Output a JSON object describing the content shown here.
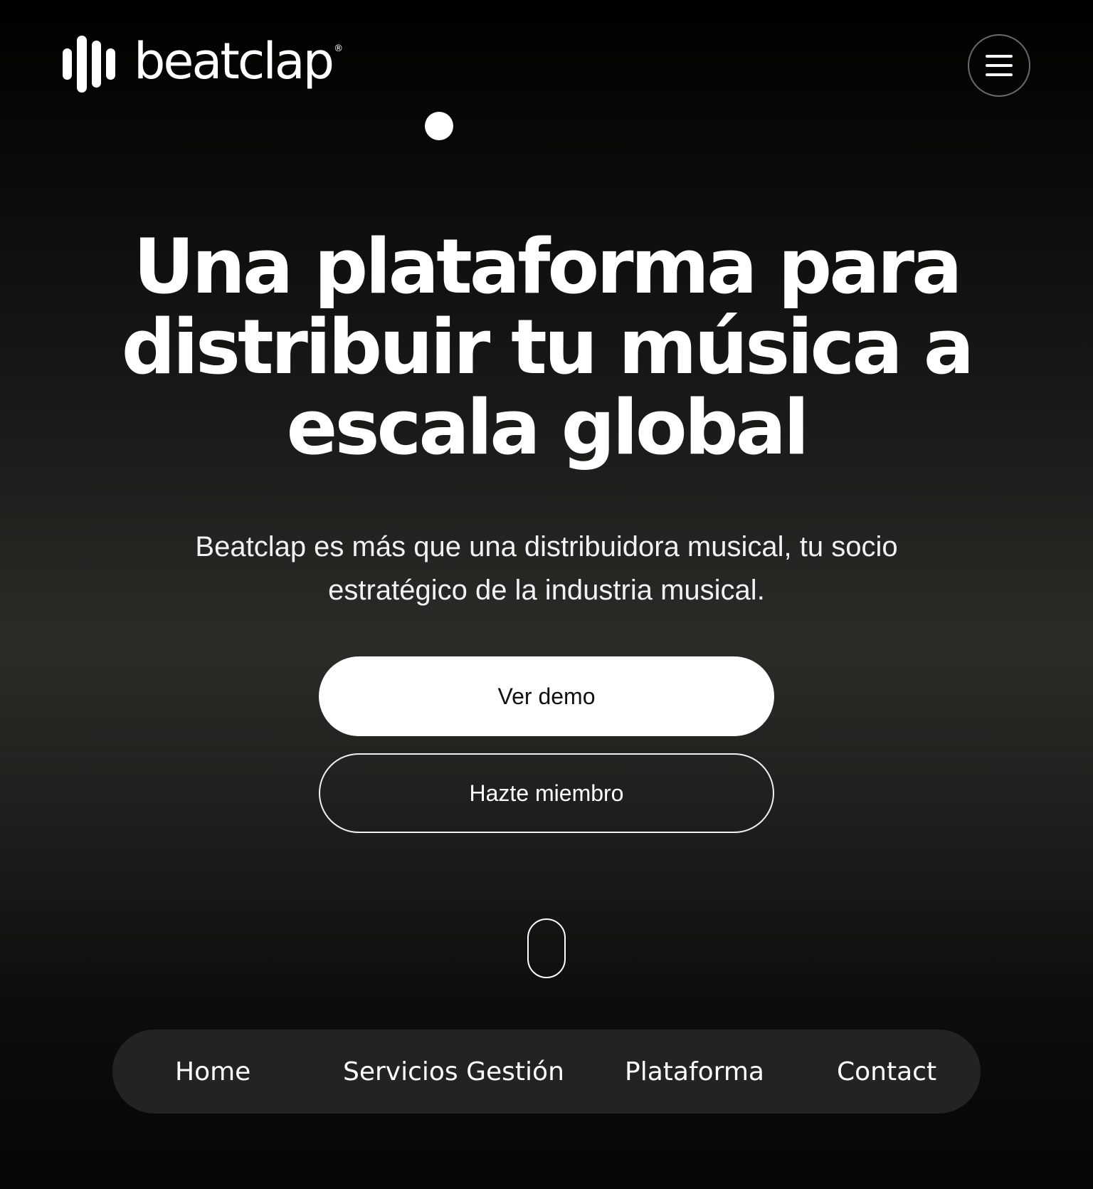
{
  "header": {
    "logo_text": "beatclap",
    "logo_reg": "®",
    "menu_icon": "hamburger-icon"
  },
  "hero": {
    "title": "Una plataforma para distribuir tu música a escala global",
    "subtitle": "Beatclap es más que una distribuidora musical, tu socio estratégico de la industria musical."
  },
  "buttons": {
    "demo_label": "Ver demo",
    "member_label": "Hazte miembro"
  },
  "bottom_nav": {
    "items": [
      {
        "label": "Home"
      },
      {
        "label": "Servicios Gestión"
      },
      {
        "label": "Plataforma"
      },
      {
        "label": "Contact"
      }
    ]
  },
  "colors": {
    "background": "#000000",
    "nav_background": "#232323",
    "primary_button": "#ffffff",
    "text": "#ffffff"
  }
}
